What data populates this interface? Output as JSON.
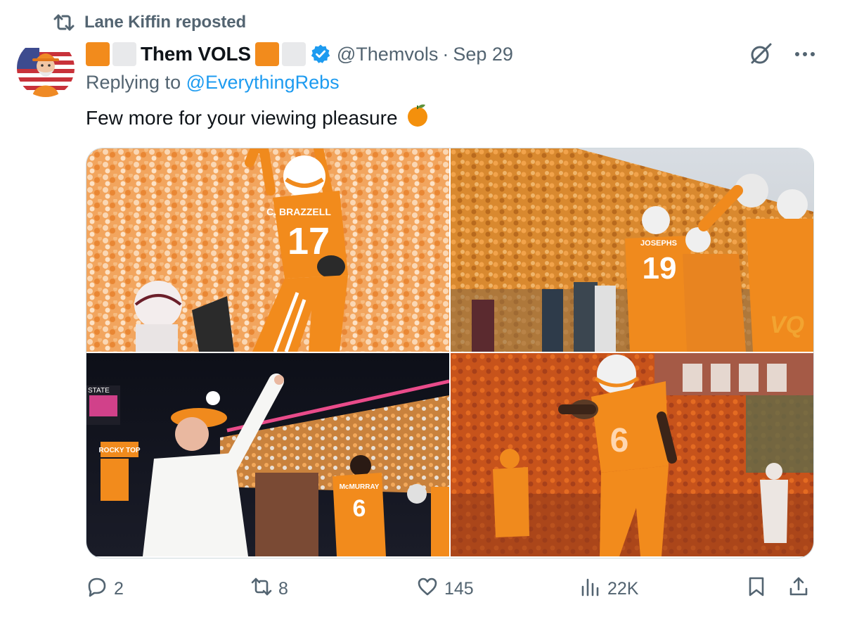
{
  "social_context": {
    "text": "Lane Kiffin reposted"
  },
  "author": {
    "name": "Them VOLS",
    "handle": "@Themvols",
    "separator": "·",
    "date": "Sep 29",
    "verified": true
  },
  "reply": {
    "prefix": "Replying to",
    "mention": "@EverythingRebs"
  },
  "tweet": {
    "text": "Few more for your viewing pleasure",
    "emoji_icon": "orange-icon"
  },
  "media": {
    "photos": [
      {
        "jersey_name": "C. BRAZZELL",
        "jersey_number": "17"
      },
      {
        "jersey_name": "JOSEPHS",
        "jersey_number": "19",
        "watermark": "VQ"
      },
      {
        "sign_text": "ROCKY TOP",
        "jersey_name": "McMURRAY",
        "jersey_number": "6",
        "board_text": "STATE"
      },
      {
        "jersey_number": "6"
      }
    ]
  },
  "actions": {
    "replies": "2",
    "reposts": "8",
    "likes": "145",
    "views": "22K"
  },
  "colors": {
    "accent": "#1d9bf0",
    "secondary_text": "#536471",
    "tennessee_orange": "#f28b1c"
  }
}
